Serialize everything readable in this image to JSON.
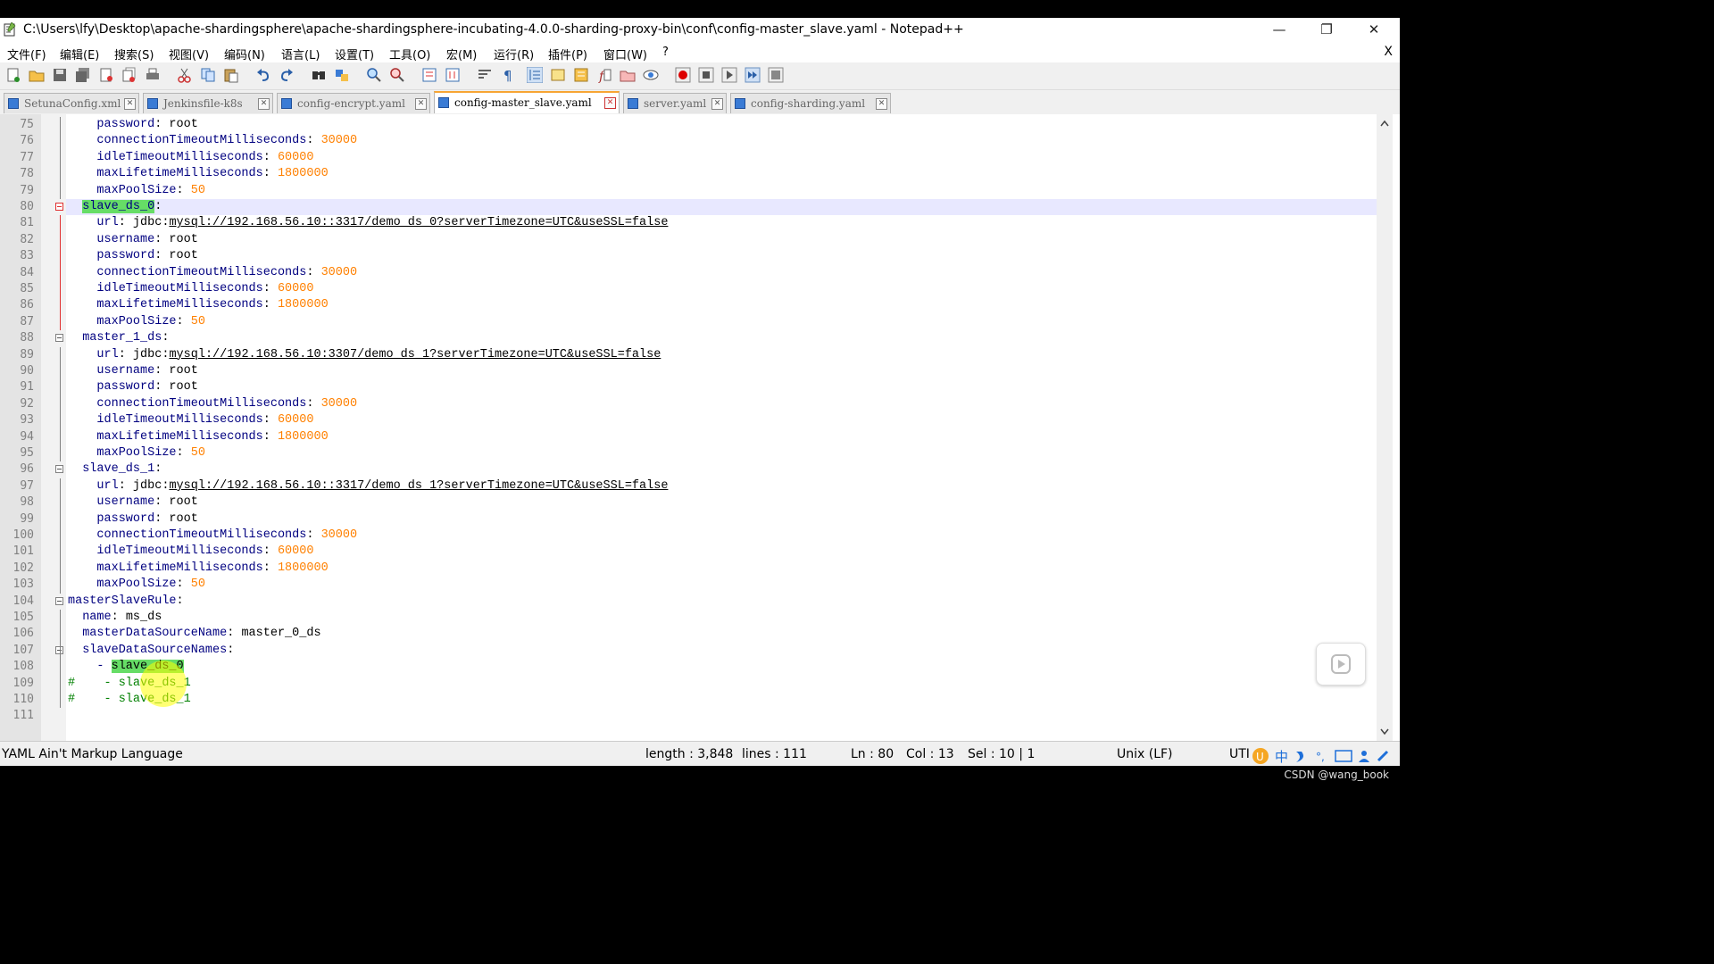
{
  "window": {
    "title": "C:\\Users\\lfy\\Desktop\\apache-shardingsphere\\apache-shardingsphere-incubating-4.0.0-sharding-proxy-bin\\conf\\config-master_slave.yaml - Notepad++",
    "controls": {
      "minimize": "—",
      "restore": "❐",
      "close": "✕"
    }
  },
  "menu": {
    "items": [
      "文件(F)",
      "编辑(E)",
      "搜索(S)",
      "视图(V)",
      "编码(N)",
      "语言(L)",
      "设置(T)",
      "工具(O)",
      "宏(M)",
      "运行(R)",
      "插件(P)",
      "窗口(W)",
      "?"
    ],
    "close": "X"
  },
  "toolbar": {
    "icons": [
      "new-file-icon",
      "open-file-icon",
      "save-icon",
      "save-all-icon",
      "close-icon",
      "close-all-icon",
      "print-icon",
      "cut-icon",
      "copy-icon",
      "paste-icon",
      "undo-icon",
      "redo-icon",
      "find-icon",
      "replace-icon",
      "zoom-in-icon",
      "zoom-out-icon",
      "sync-v-icon",
      "sync-h-icon",
      "wrap-icon",
      "show-all-chars-icon",
      "indent-guide-icon",
      "udl-icon",
      "doc-map-icon",
      "function-list-icon",
      "folder-workspace-icon",
      "monitor-icon",
      "record-macro-icon",
      "stop-macro-icon",
      "play-macro-icon",
      "run-macro-multiple-icon",
      "save-macro-icon"
    ]
  },
  "tabs": [
    {
      "label": "SetunaConfig.xml",
      "active": false
    },
    {
      "label": "Jenkinsfile-k8s",
      "active": false
    },
    {
      "label": "config-encrypt.yaml",
      "active": false
    },
    {
      "label": "config-master_slave.yaml",
      "active": true
    },
    {
      "label": "server.yaml",
      "active": false
    },
    {
      "label": "config-sharding.yaml",
      "active": false
    }
  ],
  "editor": {
    "current_line": 80,
    "lines": [
      {
        "n": "75",
        "indent": "    ",
        "k": "password",
        "v": "root",
        "t": "str"
      },
      {
        "n": "76",
        "indent": "    ",
        "k": "connectionTimeoutMilliseconds",
        "v": "30000",
        "t": "num"
      },
      {
        "n": "77",
        "indent": "    ",
        "k": "idleTimeoutMilliseconds",
        "v": "60000",
        "t": "num"
      },
      {
        "n": "78",
        "indent": "    ",
        "k": "maxLifetimeMilliseconds",
        "v": "1800000",
        "t": "num"
      },
      {
        "n": "79",
        "indent": "    ",
        "k": "maxPoolSize",
        "v": "50",
        "t": "num"
      },
      {
        "n": "80",
        "indent": "  ",
        "k": "slave_ds_0",
        "v": "",
        "t": "sel"
      },
      {
        "n": "81",
        "indent": "    ",
        "k": "url",
        "pre": "jdbc:",
        "v": "mysql://192.168.56.10::3317/demo_ds_0?serverTimezone=UTC&useSSL=false",
        "t": "url"
      },
      {
        "n": "82",
        "indent": "    ",
        "k": "username",
        "v": "root",
        "t": "str"
      },
      {
        "n": "83",
        "indent": "    ",
        "k": "password",
        "v": "root",
        "t": "str"
      },
      {
        "n": "84",
        "indent": "    ",
        "k": "connectionTimeoutMilliseconds",
        "v": "30000",
        "t": "num"
      },
      {
        "n": "85",
        "indent": "    ",
        "k": "idleTimeoutMilliseconds",
        "v": "60000",
        "t": "num"
      },
      {
        "n": "86",
        "indent": "    ",
        "k": "maxLifetimeMilliseconds",
        "v": "1800000",
        "t": "num"
      },
      {
        "n": "87",
        "indent": "    ",
        "k": "maxPoolSize",
        "v": "50",
        "t": "num"
      },
      {
        "n": "88",
        "indent": "  ",
        "k": "master_1_ds",
        "v": "",
        "t": "key"
      },
      {
        "n": "89",
        "indent": "    ",
        "k": "url",
        "pre": "jdbc:",
        "v": "mysql://192.168.56.10:3307/demo_ds_1?serverTimezone=UTC&useSSL=false",
        "t": "url"
      },
      {
        "n": "90",
        "indent": "    ",
        "k": "username",
        "v": "root",
        "t": "str"
      },
      {
        "n": "91",
        "indent": "    ",
        "k": "password",
        "v": "root",
        "t": "str"
      },
      {
        "n": "92",
        "indent": "    ",
        "k": "connectionTimeoutMilliseconds",
        "v": "30000",
        "t": "num"
      },
      {
        "n": "93",
        "indent": "    ",
        "k": "idleTimeoutMilliseconds",
        "v": "60000",
        "t": "num"
      },
      {
        "n": "94",
        "indent": "    ",
        "k": "maxLifetimeMilliseconds",
        "v": "1800000",
        "t": "num"
      },
      {
        "n": "95",
        "indent": "    ",
        "k": "maxPoolSize",
        "v": "50",
        "t": "num"
      },
      {
        "n": "96",
        "indent": "  ",
        "k": "slave_ds_1",
        "v": "",
        "t": "key"
      },
      {
        "n": "97",
        "indent": "    ",
        "k": "url",
        "pre": "jdbc:",
        "v": "mysql://192.168.56.10::3317/demo_ds_1?serverTimezone=UTC&useSSL=false",
        "t": "url"
      },
      {
        "n": "98",
        "indent": "    ",
        "k": "username",
        "v": "root",
        "t": "str"
      },
      {
        "n": "99",
        "indent": "    ",
        "k": "password",
        "v": "root",
        "t": "str"
      },
      {
        "n": "100",
        "indent": "    ",
        "k": "connectionTimeoutMilliseconds",
        "v": "30000",
        "t": "num"
      },
      {
        "n": "101",
        "indent": "    ",
        "k": "idleTimeoutMilliseconds",
        "v": "60000",
        "t": "num"
      },
      {
        "n": "102",
        "indent": "    ",
        "k": "maxLifetimeMilliseconds",
        "v": "1800000",
        "t": "num"
      },
      {
        "n": "103",
        "indent": "    ",
        "k": "maxPoolSize",
        "v": "50",
        "t": "num"
      },
      {
        "n": "104",
        "indent": "",
        "k": "masterSlaveRule",
        "v": "",
        "t": "key"
      },
      {
        "n": "105",
        "indent": "  ",
        "k": "name",
        "v": "ms_ds",
        "t": "str"
      },
      {
        "n": "106",
        "indent": "  ",
        "k": "masterDataSourceName",
        "v": "master_0_ds",
        "t": "str"
      },
      {
        "n": "107",
        "indent": "  ",
        "k": "slaveDataSourceNames",
        "v": "",
        "t": "key"
      },
      {
        "n": "108",
        "indent": "    ",
        "k": "- ",
        "v": "slave_ds_0",
        "t": "listsel"
      },
      {
        "n": "109",
        "indent": "",
        "k": "",
        "v": "#    - slave_ds_1",
        "t": "comment"
      },
      {
        "n": "110",
        "indent": "",
        "k": "",
        "v": "#    - slave_ds_1",
        "t": "comment"
      },
      {
        "n": "111",
        "indent": "",
        "k": "",
        "v": "",
        "t": "empty"
      }
    ]
  },
  "status": {
    "language": "YAML Ain't Markup Language",
    "length": "length : 3,848",
    "lines": "lines : 111",
    "ln": "Ln : 80",
    "col": "Col : 13",
    "sel": "Sel : 10 | 1",
    "eol": "Unix (LF)",
    "encoding": "UTI"
  },
  "watermark": "CSDN @wang_book"
}
